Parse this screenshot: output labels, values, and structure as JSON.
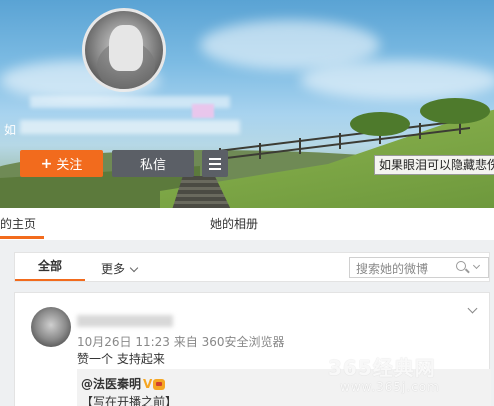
{
  "profile": {
    "description_prefix": "如",
    "follow_label": "关注",
    "message_label": "私信",
    "menu_icon": "hamburger-menu-icon",
    "tooltip": "如果眼泪可以隐藏悲伤"
  },
  "tabs": {
    "home": "她的主页",
    "album": "她的相册"
  },
  "filter": {
    "all_label": "全部",
    "more_label": "更多",
    "search_placeholder": "搜索她的微博"
  },
  "post": {
    "time": "10月26日 11:23",
    "source_prefix": "来自",
    "source": "360安全浏览器",
    "text": "赞一个 支持起来",
    "repost": {
      "author": "@法医秦明",
      "text": "【写在开播之前】"
    }
  },
  "watermark": {
    "brand": "365经典网",
    "url": "www.365j.com"
  },
  "colors": {
    "accent": "#f26b1d",
    "dark_button": "#5b5f66",
    "verified_badge": "#f5a623"
  }
}
